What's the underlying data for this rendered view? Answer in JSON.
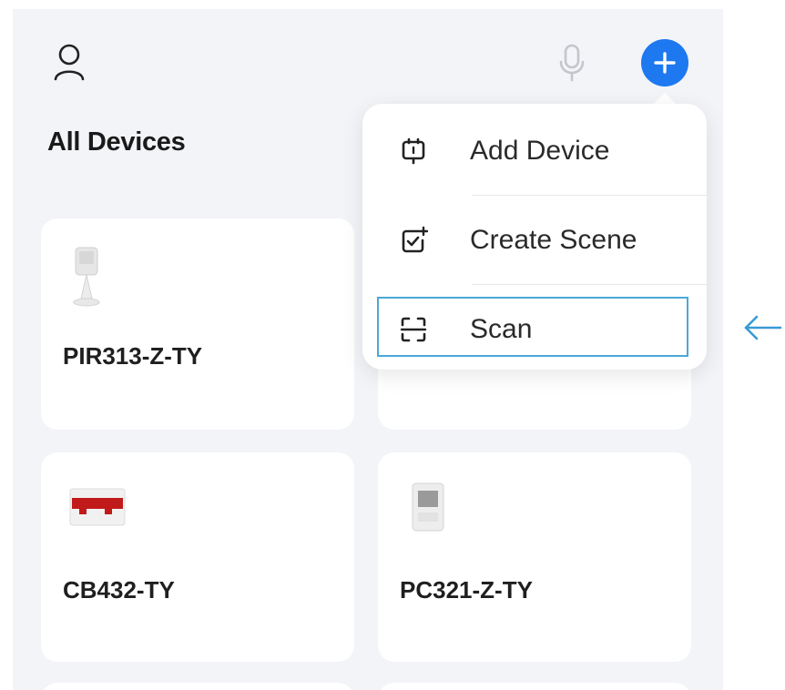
{
  "header": {
    "user_icon": "user-icon",
    "mic_icon": "microphone-icon",
    "add_icon": "plus-icon"
  },
  "page": {
    "title": "All Devices"
  },
  "menu": {
    "items": [
      {
        "label": "Add Device",
        "icon": "add-device-icon"
      },
      {
        "label": "Create Scene",
        "icon": "create-scene-icon"
      },
      {
        "label": "Scan",
        "icon": "scan-icon"
      }
    ]
  },
  "devices": [
    {
      "name": "PIR313-Z-TY",
      "icon": "motion-sensor-image"
    },
    {
      "name": "",
      "icon": ""
    },
    {
      "name": "CB432-TY",
      "icon": "circuit-breaker-image"
    },
    {
      "name": "PC321-Z-TY",
      "icon": "power-clamp-image"
    }
  ],
  "colors": {
    "accent": "#1e78f0",
    "highlight": "#4aa8d8",
    "background": "#f3f4f8"
  }
}
